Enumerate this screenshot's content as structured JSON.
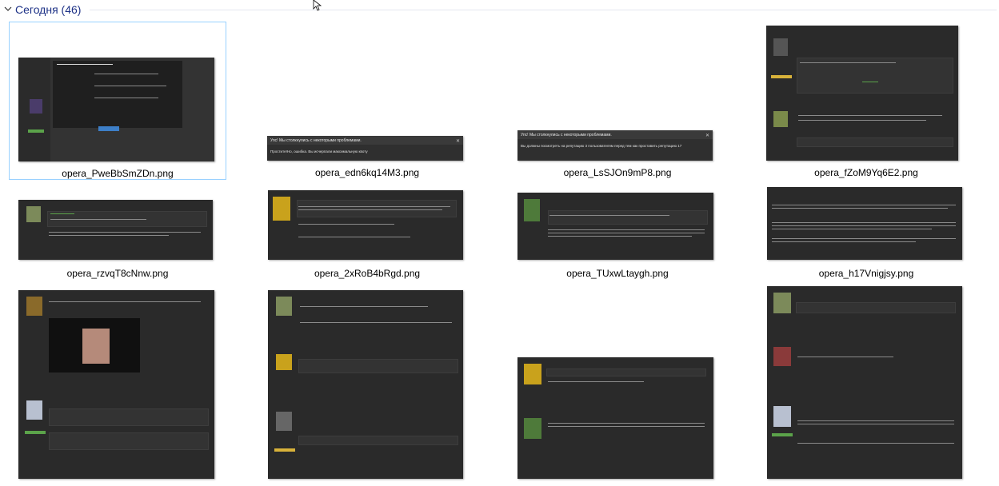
{
  "group": {
    "title": "Сегодня (46)"
  },
  "files": [
    {
      "name": "opera_PweBbSmZDn.png"
    },
    {
      "name": "opera_edn6kq14M3.png",
      "dialog_title": "Упс! Мы столкнулись с некоторыми проблемами.",
      "dialog_message": "Простите!Но, ошибка. Вы исчерпали максимальную квоту"
    },
    {
      "name": "opera_LsSJOn9mP8.png",
      "dialog_title": "Упс! Мы столкнулись с некоторыми проблемами.",
      "dialog_message": "Вы должны посмотреть на репутацию 3 пользователям перед тем как проставить репутацию 17 "
    },
    {
      "name": "opera_fZoM9Yq6E2.png"
    },
    {
      "name": "opera_rzvqT8cNnw.png"
    },
    {
      "name": "opera_2xRoB4bRgd.png"
    },
    {
      "name": "opera_TUxwLtaygh.png"
    },
    {
      "name": "opera_h17Vnigjsy.png"
    },
    {
      "name": ""
    },
    {
      "name": ""
    },
    {
      "name": ""
    },
    {
      "name": ""
    }
  ]
}
